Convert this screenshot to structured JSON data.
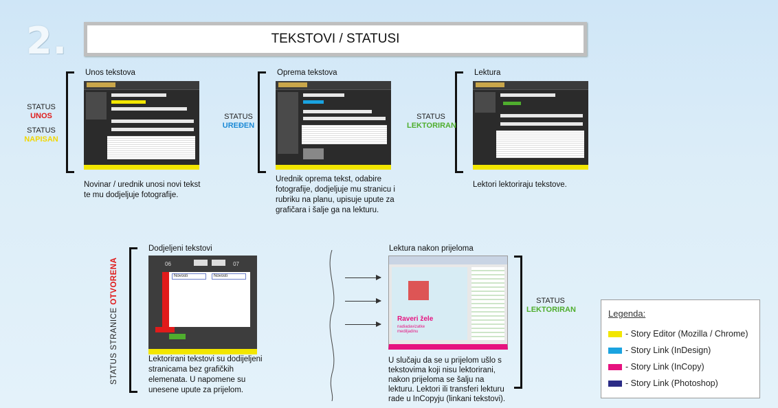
{
  "step_number": "2.",
  "title": "TEKSTOVI / STATUSI",
  "sections": {
    "unos": {
      "title": "Unos tekstova",
      "status_label_1": "STATUS",
      "status_value_1": "UNOS",
      "status_label_2": "STATUS",
      "status_value_2": "NAPISAN",
      "desc": "Novinar / urednik unosi novi tekst te mu dodjeljuje fotografije."
    },
    "oprema": {
      "title": "Oprema tekstova",
      "status_label": "STATUS",
      "status_value": "UREĐEN",
      "desc": "Urednik oprema tekst, odabire fotografije, dodjeljuje mu stranicu i rubriku na planu, upisuje upute za grafičara i šalje ga na lekturu."
    },
    "lektura": {
      "title": "Lektura",
      "status_label": "STATUS",
      "status_value": "LEKTORIRAN",
      "desc": "Lektori lektoriraju tekstove."
    },
    "dodijeljeni": {
      "title": "Dodjeljeni tekstovi",
      "vertical_status_black": "STATUS STRANICE ",
      "vertical_status_red": "OTVORENA",
      "page_left": "06",
      "page_right": "07",
      "dropdown_1": "Novosti",
      "dropdown_2": "Novosti",
      "desc": "Lektorirani tekstovi su dodijeljeni stranicama bez grafičkih elemenata. U napomene su unesene upute za prijelom."
    },
    "nakon": {
      "title": "Lektura nakon prijeloma",
      "headline": "Raveri žele",
      "subheadline": "nadiadavizatke mediljadinu",
      "status_label": "STATUS",
      "status_value": "LEKTORIRAN",
      "desc": "U slučaju da se u prijelom ušlo s tekstovima koji nisu lektorirani, nakon prijeloma se šalju na lekturu. Lektori ili transferi lekturu rade u InCopyju (linkani tekstovi)."
    }
  },
  "legend": {
    "title": "Legenda:",
    "items": [
      {
        "label": "- Story Editor (Mozilla / Chrome)",
        "color": "#f2e600"
      },
      {
        "label": "- Story Link  (InDesign)",
        "color": "#1aa3e0"
      },
      {
        "label": "- Story Link  (InCopy)",
        "color": "#e6127f"
      },
      {
        "label": "- Story Link  (Photoshop)",
        "color": "#2b2c86"
      }
    ]
  },
  "colors": {
    "unos": "#e01b1b",
    "napisan": "#f2d600",
    "uredjen": "#1c8ad6",
    "lektoriran": "#4fae2e",
    "otvorena": "#e01b1b"
  }
}
